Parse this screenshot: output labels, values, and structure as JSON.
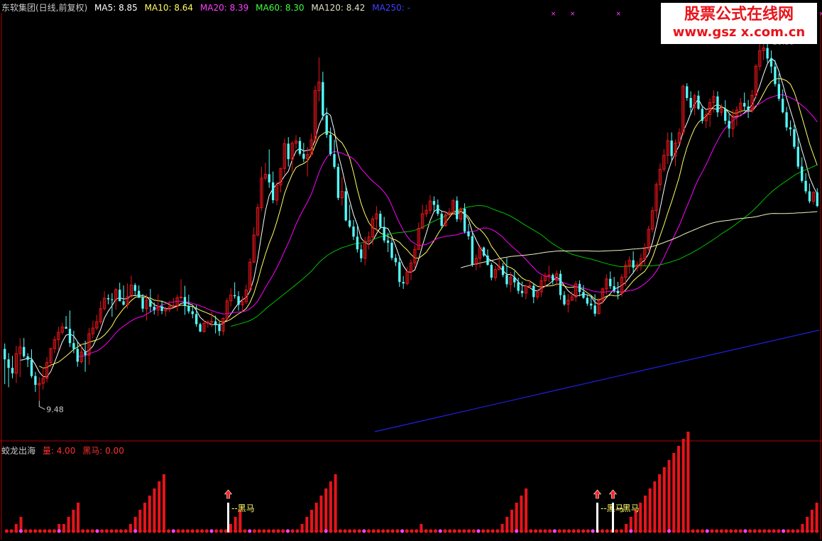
{
  "header": {
    "stock_name": "东软集团(日线,前复权)",
    "ma5": "MA5: 8.85",
    "ma10": "MA10: 8.64",
    "ma20": "MA20: 8.39",
    "ma60": "MA60: 8.30",
    "ma120": "MA120: 8.42",
    "ma250": "MA250: -"
  },
  "sub_header": {
    "name": "蛟龙出海",
    "volume": "量: 4.00",
    "blackhorse": "黑马: 0.00"
  },
  "watermark": {
    "line1": "股票公式在线网",
    "line2": "www.gsz x.com.cn"
  },
  "colors": {
    "up": "#e8141b",
    "down": "#54fcfc",
    "ma5": "#ffffff",
    "ma10": "#ffff66",
    "ma20": "#ff00ff",
    "ma60": "#00c000",
    "ma120": "#f0f0c0",
    "ma250": "#2020e8",
    "frame": "#b00000"
  },
  "price_labels": {
    "high": "18.35",
    "low": "9.48"
  },
  "signal_label": "黑马",
  "chart_data": {
    "type": "candlestick",
    "ylim": [
      8.5,
      19.5
    ],
    "ohlc": [
      [
        10.82,
        10.96,
        9.91,
        10.55
      ],
      [
        10.55,
        10.71,
        9.83,
        10.33
      ],
      [
        10.33,
        10.64,
        10.06,
        10.19
      ],
      [
        10.19,
        10.9,
        9.94,
        10.7
      ],
      [
        10.7,
        11.1,
        10.09,
        10.87
      ],
      [
        10.87,
        11.1,
        10.59,
        10.63
      ],
      [
        10.63,
        10.71,
        10.35,
        10.54
      ],
      [
        10.54,
        10.81,
        10.07,
        10.12
      ],
      [
        10.12,
        10.23,
        9.71,
        9.89
      ],
      [
        9.89,
        10.09,
        9.48,
        9.93
      ],
      [
        9.93,
        10.35,
        9.77,
        10.06
      ],
      [
        10.06,
        10.61,
        9.96,
        10.47
      ],
      [
        10.47,
        10.85,
        10.35,
        10.83
      ],
      [
        10.83,
        11.15,
        10.71,
        11.06
      ],
      [
        11.06,
        11.39,
        10.78,
        11.25
      ],
      [
        11.25,
        11.5,
        11.19,
        11.39
      ],
      [
        11.39,
        11.67,
        11.36,
        11.34
      ],
      [
        11.34,
        11.81,
        10.87,
        10.97
      ],
      [
        10.97,
        11.29,
        10.71,
        10.82
      ],
      [
        10.82,
        11.01,
        10.36,
        10.49
      ],
      [
        10.49,
        10.95,
        10.44,
        10.74
      ],
      [
        10.74,
        11.03,
        10.23,
        10.66
      ],
      [
        10.66,
        11.36,
        10.41,
        11.21
      ],
      [
        11.21,
        11.55,
        11.09,
        11.36
      ],
      [
        11.36,
        11.7,
        11.31,
        11.52
      ],
      [
        11.52,
        12.06,
        11.46,
        11.86
      ],
      [
        11.86,
        12.31,
        11.81,
        12.13
      ],
      [
        12.13,
        12.23,
        11.97,
        12.1
      ],
      [
        12.1,
        12.26,
        11.65,
        12.08
      ],
      [
        12.08,
        12.39,
        11.83,
        12.35
      ],
      [
        12.35,
        12.53,
        12.12,
        12.05
      ],
      [
        12.05,
        12.46,
        11.94,
        11.96
      ],
      [
        11.96,
        12.51,
        11.86,
        12.17
      ],
      [
        12.17,
        12.71,
        12.14,
        12.47
      ],
      [
        12.47,
        12.52,
        12.19,
        12.32
      ],
      [
        12.32,
        12.46,
        12.14,
        12.14
      ],
      [
        12.14,
        12.24,
        11.77,
        11.86
      ],
      [
        11.86,
        12.23,
        11.55,
        12.08
      ],
      [
        12.08,
        12.37,
        11.77,
        11.91
      ],
      [
        11.91,
        12.02,
        11.71,
        11.82
      ],
      [
        11.82,
        12.23,
        11.67,
        11.92
      ],
      [
        11.92,
        12.07,
        11.72,
        11.8
      ],
      [
        11.8,
        11.91,
        11.66,
        11.84
      ],
      [
        11.84,
        12.06,
        11.77,
        11.91
      ],
      [
        11.91,
        12.14,
        11.91,
        11.94
      ],
      [
        11.94,
        12.22,
        11.79,
        12.14
      ],
      [
        12.14,
        12.62,
        12.1,
        12.16
      ],
      [
        12.16,
        12.45,
        11.7,
        11.93
      ],
      [
        11.93,
        12.22,
        11.73,
        11.79
      ],
      [
        11.79,
        11.92,
        11.61,
        11.72
      ],
      [
        11.72,
        11.95,
        11.39,
        11.46
      ],
      [
        11.46,
        11.5,
        11.25,
        11.27
      ],
      [
        11.27,
        11.56,
        11.24,
        11.48
      ],
      [
        11.48,
        11.56,
        11.37,
        11.51
      ],
      [
        11.51,
        11.78,
        11.38,
        11.53
      ],
      [
        11.53,
        11.68,
        11.22,
        11.44
      ],
      [
        11.44,
        11.52,
        11.16,
        11.28
      ],
      [
        11.28,
        11.63,
        11.17,
        11.61
      ],
      [
        11.61,
        12.14,
        11.56,
        12.06
      ],
      [
        12.06,
        12.39,
        11.92,
        12.21
      ],
      [
        12.21,
        12.54,
        12.12,
        12.18
      ],
      [
        12.18,
        12.31,
        11.81,
        11.96
      ],
      [
        11.96,
        12.18,
        11.8,
        12.04
      ],
      [
        12.04,
        12.48,
        11.98,
        12.34
      ],
      [
        12.34,
        13.16,
        12.34,
        13.06
      ],
      [
        13.06,
        13.96,
        13.05,
        13.76
      ],
      [
        13.76,
        14.57,
        13.73,
        14.47
      ],
      [
        14.47,
        15.52,
        14.38,
        15.23
      ],
      [
        15.23,
        15.63,
        15.17,
        15.33
      ],
      [
        15.33,
        15.97,
        14.98,
        15.12
      ],
      [
        15.12,
        15.4,
        14.58,
        14.66
      ],
      [
        14.66,
        15.14,
        14.53,
        15.05
      ],
      [
        15.05,
        15.5,
        14.86,
        15.48
      ],
      [
        15.48,
        16.25,
        15.32,
        16.12
      ],
      [
        16.12,
        16.29,
        15.53,
        15.72
      ],
      [
        15.72,
        16.18,
        15.39,
        16.13
      ],
      [
        16.13,
        16.34,
        15.99,
        16.19
      ],
      [
        16.19,
        16.29,
        15.81,
        15.86
      ],
      [
        15.86,
        16.14,
        15.64,
        15.73
      ],
      [
        15.73,
        16.03,
        15.27,
        15.84
      ],
      [
        15.84,
        16.38,
        15.81,
        16.22
      ],
      [
        16.22,
        17.62,
        16.14,
        17.49
      ],
      [
        17.49,
        18.35,
        17.21,
        17.71
      ],
      [
        17.71,
        17.98,
        16.72,
        16.85
      ],
      [
        16.85,
        17.05,
        16.27,
        16.35
      ],
      [
        16.35,
        16.54,
        15.8,
        15.85
      ],
      [
        15.85,
        16.22,
        15.47,
        15.52
      ],
      [
        15.52,
        15.61,
        14.66,
        14.72
      ],
      [
        14.72,
        15.26,
        14.52,
        14.89
      ],
      [
        14.89,
        15.03,
        14.11,
        14.14
      ],
      [
        14.14,
        14.54,
        13.94,
        13.98
      ],
      [
        13.98,
        14.15,
        13.63,
        13.72
      ],
      [
        13.72,
        14.02,
        13.31,
        13.39
      ],
      [
        13.39,
        13.52,
        13.06,
        13.16
      ],
      [
        13.16,
        13.71,
        12.98,
        13.6
      ],
      [
        13.6,
        13.85,
        13.39,
        13.71
      ],
      [
        13.71,
        14.26,
        13.51,
        14.18
      ],
      [
        14.18,
        14.51,
        13.85,
        14.31
      ],
      [
        14.31,
        14.39,
        13.91,
        13.97
      ],
      [
        13.97,
        14.23,
        13.56,
        13.62
      ],
      [
        13.62,
        13.82,
        13.32,
        13.56
      ],
      [
        13.56,
        13.65,
        13.11,
        13.17
      ],
      [
        13.17,
        13.27,
        12.96,
        13.06
      ],
      [
        13.06,
        13.2,
        12.42,
        12.55
      ],
      [
        12.55,
        12.7,
        12.37,
        12.51
      ],
      [
        12.51,
        12.94,
        12.46,
        12.81
      ],
      [
        12.81,
        13.13,
        12.6,
        13.04
      ],
      [
        13.04,
        13.5,
        12.9,
        13.39
      ],
      [
        13.39,
        14.08,
        13.37,
        13.93
      ],
      [
        13.93,
        14.54,
        13.93,
        14.31
      ],
      [
        14.31,
        14.54,
        14.22,
        14.4
      ],
      [
        14.4,
        14.79,
        14.31,
        14.64
      ],
      [
        14.64,
        14.76,
        14.37,
        14.54
      ],
      [
        14.54,
        14.68,
        14.25,
        14.31
      ],
      [
        14.31,
        14.38,
        13.92,
        14.0
      ],
      [
        14.0,
        14.39,
        13.98,
        14.28
      ],
      [
        14.28,
        14.46,
        14.23,
        14.35
      ],
      [
        14.35,
        14.7,
        14.27,
        14.65
      ],
      [
        14.65,
        14.76,
        14.1,
        14.17
      ],
      [
        14.17,
        14.48,
        14.08,
        14.44
      ],
      [
        14.44,
        14.58,
        13.8,
        13.85
      ],
      [
        13.85,
        14.05,
        13.64,
        13.73
      ],
      [
        13.73,
        13.86,
        12.94,
        13.0
      ],
      [
        13.0,
        13.26,
        12.85,
        13.16
      ],
      [
        13.16,
        13.49,
        12.92,
        13.44
      ],
      [
        13.44,
        13.46,
        13.19,
        13.23
      ],
      [
        13.23,
        13.39,
        12.97,
        12.99
      ],
      [
        12.99,
        13.04,
        12.59,
        12.66
      ],
      [
        12.66,
        12.96,
        12.58,
        12.87
      ],
      [
        12.87,
        13.15,
        12.84,
        12.96
      ],
      [
        12.96,
        13.04,
        12.67,
        12.73
      ],
      [
        12.73,
        13.17,
        12.41,
        12.49
      ],
      [
        12.49,
        12.81,
        12.29,
        12.67
      ],
      [
        12.67,
        12.83,
        12.41,
        12.54
      ],
      [
        12.54,
        12.66,
        12.24,
        12.32
      ],
      [
        12.32,
        12.56,
        12.16,
        12.26
      ],
      [
        12.26,
        12.48,
        12.1,
        12.44
      ],
      [
        12.44,
        12.61,
        12.38,
        12.45
      ],
      [
        12.45,
        12.52,
        12.0,
        12.16
      ],
      [
        12.16,
        12.33,
        12.09,
        12.29
      ],
      [
        12.29,
        12.71,
        12.16,
        12.58
      ],
      [
        12.58,
        12.79,
        12.41,
        12.71
      ],
      [
        12.71,
        12.97,
        12.55,
        12.73
      ],
      [
        12.73,
        12.77,
        12.48,
        12.59
      ],
      [
        12.59,
        12.85,
        12.44,
        12.76
      ],
      [
        12.76,
        12.85,
        12.09,
        12.21
      ],
      [
        12.21,
        12.31,
        11.93,
        11.97
      ],
      [
        11.97,
        12.24,
        11.76,
        12.08
      ],
      [
        12.08,
        12.31,
        12.06,
        12.16
      ],
      [
        12.16,
        12.58,
        12.04,
        12.5
      ],
      [
        12.5,
        12.59,
        12.18,
        12.29
      ],
      [
        12.29,
        12.47,
        12.11,
        12.14
      ],
      [
        12.14,
        12.23,
        11.93,
        11.99
      ],
      [
        11.99,
        12.21,
        11.84,
        11.94
      ],
      [
        11.94,
        12.23,
        11.66,
        11.73
      ],
      [
        11.73,
        12.13,
        11.72,
        12.07
      ],
      [
        12.07,
        12.41,
        11.99,
        12.37
      ],
      [
        12.37,
        12.75,
        12.23,
        12.63
      ],
      [
        12.63,
        12.82,
        12.37,
        12.44
      ],
      [
        12.44,
        12.68,
        12.26,
        12.32
      ],
      [
        12.32,
        12.55,
        12.1,
        12.26
      ],
      [
        12.26,
        12.75,
        12.17,
        12.67
      ],
      [
        12.67,
        13.09,
        12.44,
        12.98
      ],
      [
        12.98,
        13.21,
        12.77,
        13.11
      ],
      [
        13.11,
        13.34,
        12.77,
        12.92
      ],
      [
        12.92,
        13.08,
        12.82,
        12.99
      ],
      [
        12.99,
        13.28,
        12.85,
        13.15
      ],
      [
        13.15,
        13.55,
        12.97,
        13.4
      ],
      [
        13.4,
        14.0,
        13.36,
        13.91
      ],
      [
        13.91,
        14.49,
        13.83,
        14.39
      ],
      [
        14.39,
        15.12,
        14.19,
        15.06
      ],
      [
        15.06,
        15.61,
        14.9,
        15.46
      ],
      [
        15.46,
        15.98,
        15.39,
        15.82
      ],
      [
        15.82,
        16.41,
        15.6,
        16.2
      ],
      [
        16.2,
        16.41,
        15.69,
        15.8
      ],
      [
        15.8,
        16.23,
        15.54,
        16.14
      ],
      [
        16.14,
        16.52,
        16.11,
        16.4
      ],
      [
        16.4,
        17.65,
        16.34,
        17.6
      ],
      [
        17.6,
        17.68,
        17.23,
        17.3
      ],
      [
        17.3,
        17.47,
        16.87,
        17.05
      ],
      [
        17.05,
        17.41,
        16.85,
        17.36
      ],
      [
        17.36,
        17.49,
        16.99,
        17.02
      ],
      [
        17.02,
        17.09,
        16.64,
        16.71
      ],
      [
        16.71,
        17.0,
        16.52,
        16.87
      ],
      [
        16.87,
        17.29,
        16.55,
        17.18
      ],
      [
        17.18,
        17.5,
        16.92,
        17.34
      ],
      [
        17.34,
        17.47,
        16.81,
        16.93
      ],
      [
        16.93,
        17.15,
        16.84,
        17.02
      ],
      [
        17.02,
        17.24,
        16.62,
        16.71
      ],
      [
        16.71,
        16.88,
        16.28,
        16.51
      ],
      [
        16.51,
        17.01,
        16.29,
        16.84
      ],
      [
        16.84,
        17.09,
        16.58,
        16.99
      ],
      [
        16.99,
        17.3,
        16.87,
        17.17
      ],
      [
        17.17,
        17.44,
        16.97,
        17.08
      ],
      [
        17.08,
        17.25,
        16.78,
        16.98
      ],
      [
        16.98,
        17.51,
        16.92,
        17.37
      ],
      [
        17.37,
        18.17,
        17.29,
        18.12
      ],
      [
        18.12,
        18.74,
        18.01,
        18.52
      ],
      [
        18.52,
        18.83,
        18.28,
        18.59
      ],
      [
        18.59,
        18.82,
        18.21,
        18.32
      ],
      [
        18.32,
        18.53,
        17.94,
        18.11
      ],
      [
        18.11,
        18.28,
        17.6,
        17.66
      ],
      [
        17.66,
        17.93,
        17.22,
        17.28
      ],
      [
        17.28,
        17.52,
        16.9,
        16.93
      ],
      [
        16.93,
        17.07,
        16.45,
        16.54
      ],
      [
        16.54,
        16.72,
        16.32,
        16.49
      ],
      [
        16.49,
        16.61,
        15.98,
        16.04
      ],
      [
        16.04,
        16.32,
        15.47,
        15.53
      ],
      [
        15.53,
        15.77,
        15.11,
        15.16
      ],
      [
        15.16,
        15.36,
        14.83,
        14.89
      ],
      [
        14.89,
        15.09,
        14.58,
        14.63
      ],
      [
        14.63,
        14.9,
        14.55,
        14.86
      ],
      [
        14.86,
        14.97,
        14.48,
        14.51
      ]
    ],
    "markers_top": [
      143,
      148,
      160,
      201,
      207,
      213,
      218,
      224,
      230
    ],
    "sub_values": [
      0,
      0,
      1,
      2,
      0,
      0,
      0,
      0,
      0,
      0,
      0,
      1,
      1,
      2,
      3,
      4,
      0,
      0,
      0,
      0,
      0,
      0,
      0,
      0,
      0,
      0,
      1,
      2,
      3,
      4,
      5,
      6,
      7,
      8,
      0,
      0,
      0,
      0,
      0,
      0,
      0,
      0,
      0,
      0,
      0,
      0,
      0,
      1,
      2,
      3,
      0,
      0,
      0,
      0,
      0,
      0,
      0,
      0,
      0,
      0,
      0,
      0,
      1,
      2,
      3,
      4,
      5,
      6,
      7,
      8,
      0,
      0,
      0,
      0,
      0,
      0,
      0,
      0,
      0,
      0,
      0,
      0,
      0,
      0,
      0,
      0,
      0,
      1,
      0,
      0,
      0,
      0,
      0,
      0,
      0,
      0,
      0,
      0,
      0,
      0,
      0,
      0,
      0,
      0,
      1,
      2,
      3,
      4,
      5,
      6,
      0,
      0,
      0,
      0,
      0,
      0,
      0,
      0,
      0,
      0,
      0,
      0,
      0,
      0,
      0,
      0,
      0,
      0,
      0,
      0,
      1,
      2,
      3,
      4,
      5,
      6,
      7,
      8,
      9,
      10,
      11,
      12,
      13,
      14,
      0,
      0,
      0,
      0,
      0,
      0,
      0,
      0,
      0,
      0,
      0,
      0,
      0,
      0,
      0,
      0,
      0,
      0,
      0,
      0,
      0,
      0,
      0,
      1,
      2,
      3,
      4
    ],
    "signal_positions": [
      320,
      840,
      862
    ]
  }
}
